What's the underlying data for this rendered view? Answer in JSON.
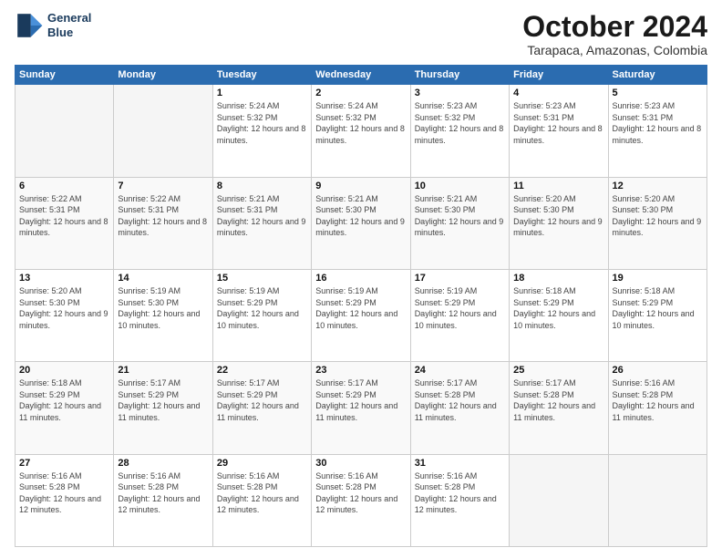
{
  "header": {
    "logo_line1": "General",
    "logo_line2": "Blue",
    "month": "October 2024",
    "location": "Tarapaca, Amazonas, Colombia"
  },
  "days_of_week": [
    "Sunday",
    "Monday",
    "Tuesday",
    "Wednesday",
    "Thursday",
    "Friday",
    "Saturday"
  ],
  "weeks": [
    [
      {
        "day": "",
        "empty": true
      },
      {
        "day": "",
        "empty": true
      },
      {
        "day": "1",
        "sunrise": "5:24 AM",
        "sunset": "5:32 PM",
        "daylight": "12 hours and 8 minutes."
      },
      {
        "day": "2",
        "sunrise": "5:24 AM",
        "sunset": "5:32 PM",
        "daylight": "12 hours and 8 minutes."
      },
      {
        "day": "3",
        "sunrise": "5:23 AM",
        "sunset": "5:32 PM",
        "daylight": "12 hours and 8 minutes."
      },
      {
        "day": "4",
        "sunrise": "5:23 AM",
        "sunset": "5:31 PM",
        "daylight": "12 hours and 8 minutes."
      },
      {
        "day": "5",
        "sunrise": "5:23 AM",
        "sunset": "5:31 PM",
        "daylight": "12 hours and 8 minutes."
      }
    ],
    [
      {
        "day": "6",
        "sunrise": "5:22 AM",
        "sunset": "5:31 PM",
        "daylight": "12 hours and 8 minutes."
      },
      {
        "day": "7",
        "sunrise": "5:22 AM",
        "sunset": "5:31 PM",
        "daylight": "12 hours and 8 minutes."
      },
      {
        "day": "8",
        "sunrise": "5:21 AM",
        "sunset": "5:31 PM",
        "daylight": "12 hours and 9 minutes."
      },
      {
        "day": "9",
        "sunrise": "5:21 AM",
        "sunset": "5:30 PM",
        "daylight": "12 hours and 9 minutes."
      },
      {
        "day": "10",
        "sunrise": "5:21 AM",
        "sunset": "5:30 PM",
        "daylight": "12 hours and 9 minutes."
      },
      {
        "day": "11",
        "sunrise": "5:20 AM",
        "sunset": "5:30 PM",
        "daylight": "12 hours and 9 minutes."
      },
      {
        "day": "12",
        "sunrise": "5:20 AM",
        "sunset": "5:30 PM",
        "daylight": "12 hours and 9 minutes."
      }
    ],
    [
      {
        "day": "13",
        "sunrise": "5:20 AM",
        "sunset": "5:30 PM",
        "daylight": "12 hours and 9 minutes."
      },
      {
        "day": "14",
        "sunrise": "5:19 AM",
        "sunset": "5:30 PM",
        "daylight": "12 hours and 10 minutes."
      },
      {
        "day": "15",
        "sunrise": "5:19 AM",
        "sunset": "5:29 PM",
        "daylight": "12 hours and 10 minutes."
      },
      {
        "day": "16",
        "sunrise": "5:19 AM",
        "sunset": "5:29 PM",
        "daylight": "12 hours and 10 minutes."
      },
      {
        "day": "17",
        "sunrise": "5:19 AM",
        "sunset": "5:29 PM",
        "daylight": "12 hours and 10 minutes."
      },
      {
        "day": "18",
        "sunrise": "5:18 AM",
        "sunset": "5:29 PM",
        "daylight": "12 hours and 10 minutes."
      },
      {
        "day": "19",
        "sunrise": "5:18 AM",
        "sunset": "5:29 PM",
        "daylight": "12 hours and 10 minutes."
      }
    ],
    [
      {
        "day": "20",
        "sunrise": "5:18 AM",
        "sunset": "5:29 PM",
        "daylight": "12 hours and 11 minutes."
      },
      {
        "day": "21",
        "sunrise": "5:17 AM",
        "sunset": "5:29 PM",
        "daylight": "12 hours and 11 minutes."
      },
      {
        "day": "22",
        "sunrise": "5:17 AM",
        "sunset": "5:29 PM",
        "daylight": "12 hours and 11 minutes."
      },
      {
        "day": "23",
        "sunrise": "5:17 AM",
        "sunset": "5:29 PM",
        "daylight": "12 hours and 11 minutes."
      },
      {
        "day": "24",
        "sunrise": "5:17 AM",
        "sunset": "5:28 PM",
        "daylight": "12 hours and 11 minutes."
      },
      {
        "day": "25",
        "sunrise": "5:17 AM",
        "sunset": "5:28 PM",
        "daylight": "12 hours and 11 minutes."
      },
      {
        "day": "26",
        "sunrise": "5:16 AM",
        "sunset": "5:28 PM",
        "daylight": "12 hours and 11 minutes."
      }
    ],
    [
      {
        "day": "27",
        "sunrise": "5:16 AM",
        "sunset": "5:28 PM",
        "daylight": "12 hours and 12 minutes."
      },
      {
        "day": "28",
        "sunrise": "5:16 AM",
        "sunset": "5:28 PM",
        "daylight": "12 hours and 12 minutes."
      },
      {
        "day": "29",
        "sunrise": "5:16 AM",
        "sunset": "5:28 PM",
        "daylight": "12 hours and 12 minutes."
      },
      {
        "day": "30",
        "sunrise": "5:16 AM",
        "sunset": "5:28 PM",
        "daylight": "12 hours and 12 minutes."
      },
      {
        "day": "31",
        "sunrise": "5:16 AM",
        "sunset": "5:28 PM",
        "daylight": "12 hours and 12 minutes."
      },
      {
        "day": "",
        "empty": true
      },
      {
        "day": "",
        "empty": true
      }
    ]
  ]
}
